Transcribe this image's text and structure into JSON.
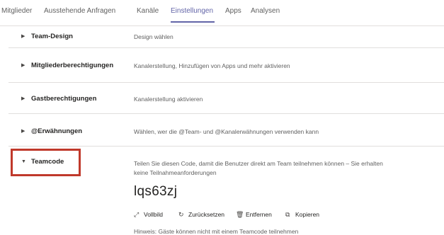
{
  "tabs": [
    {
      "label": "Mitglieder"
    },
    {
      "label": "Ausstehende Anfragen"
    },
    {
      "label": "Kanäle"
    },
    {
      "label": "Einstellungen",
      "active": true
    },
    {
      "label": "Apps"
    },
    {
      "label": "Analysen"
    }
  ],
  "settings": [
    {
      "title": "Team-Design",
      "desc": "Design wählen"
    },
    {
      "title": "Mitgliederberechtigungen",
      "desc": "Kanalerstellung, Hinzufügen von Apps und mehr aktivieren"
    },
    {
      "title": "Gastberechtigungen",
      "desc": "Kanalerstellung aktivieren"
    },
    {
      "title": "@Erwähnungen",
      "desc": "Wählen, wer die @Team- und @Kanalerwähnungen verwenden kann"
    },
    {
      "title": "Teamcode",
      "desc_line1": "Teilen Sie diesen Code, damit die Benutzer direkt am Team teilnehmen können – Sie erhalten",
      "desc_line2": "keine Teilnahmeanforderungen",
      "code": "lqs63zj",
      "actions": {
        "fullscreen": "Vollbild",
        "reset": "Zurücksetzen",
        "remove": "Entfernen",
        "copy": "Kopieren"
      },
      "hint": "Hinweis: Gäste können nicht mit einem Teamcode teilnehmen"
    }
  ],
  "colors": {
    "accent": "#6264a7",
    "highlight": "#c0392b"
  }
}
